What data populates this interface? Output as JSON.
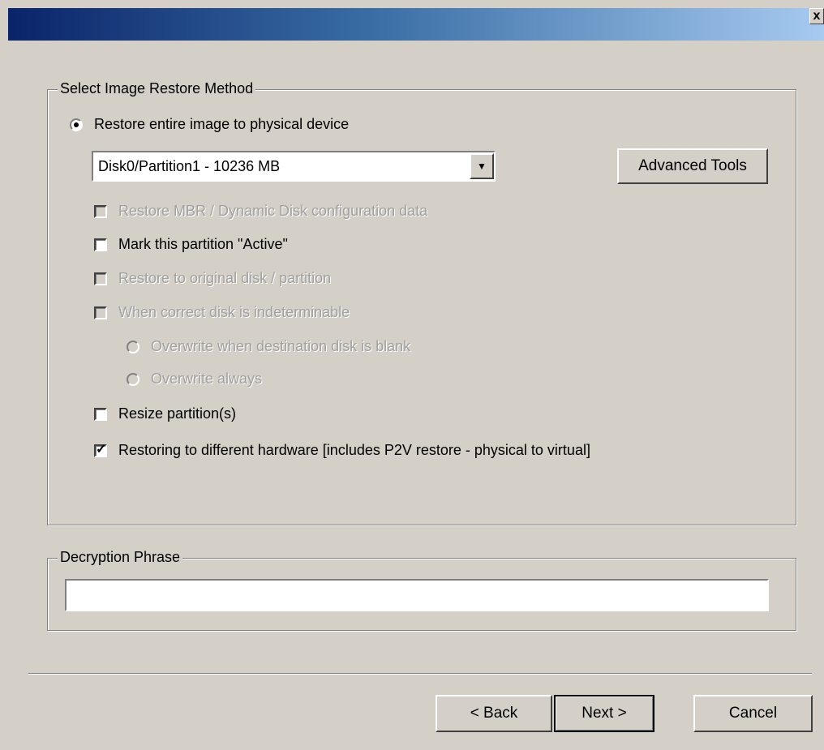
{
  "window": {
    "close_label": "x"
  },
  "restore_method": {
    "group_label": "Select Image Restore Method",
    "restore_entire_label": "Restore entire image to physical device",
    "disk_select_value": "Disk0/Partition1 - 10236 MB",
    "advanced_tools_label": "Advanced Tools",
    "options": {
      "restore_mbr": "Restore MBR / Dynamic Disk configuration data",
      "mark_active": "Mark this partition \"Active\"",
      "restore_original": "Restore to original disk / partition",
      "when_indeterminable": "When correct disk is indeterminable",
      "overwrite_blank": "Overwrite when destination disk is blank",
      "overwrite_always": "Overwrite always",
      "resize_partitions": "Resize partition(s)",
      "different_hardware": "Restoring to different hardware [includes P2V restore - physical to virtual]"
    }
  },
  "decryption": {
    "group_label": "Decryption Phrase",
    "value": ""
  },
  "footer": {
    "back_label": "< Back",
    "next_label": "Next >",
    "cancel_label": "Cancel"
  }
}
